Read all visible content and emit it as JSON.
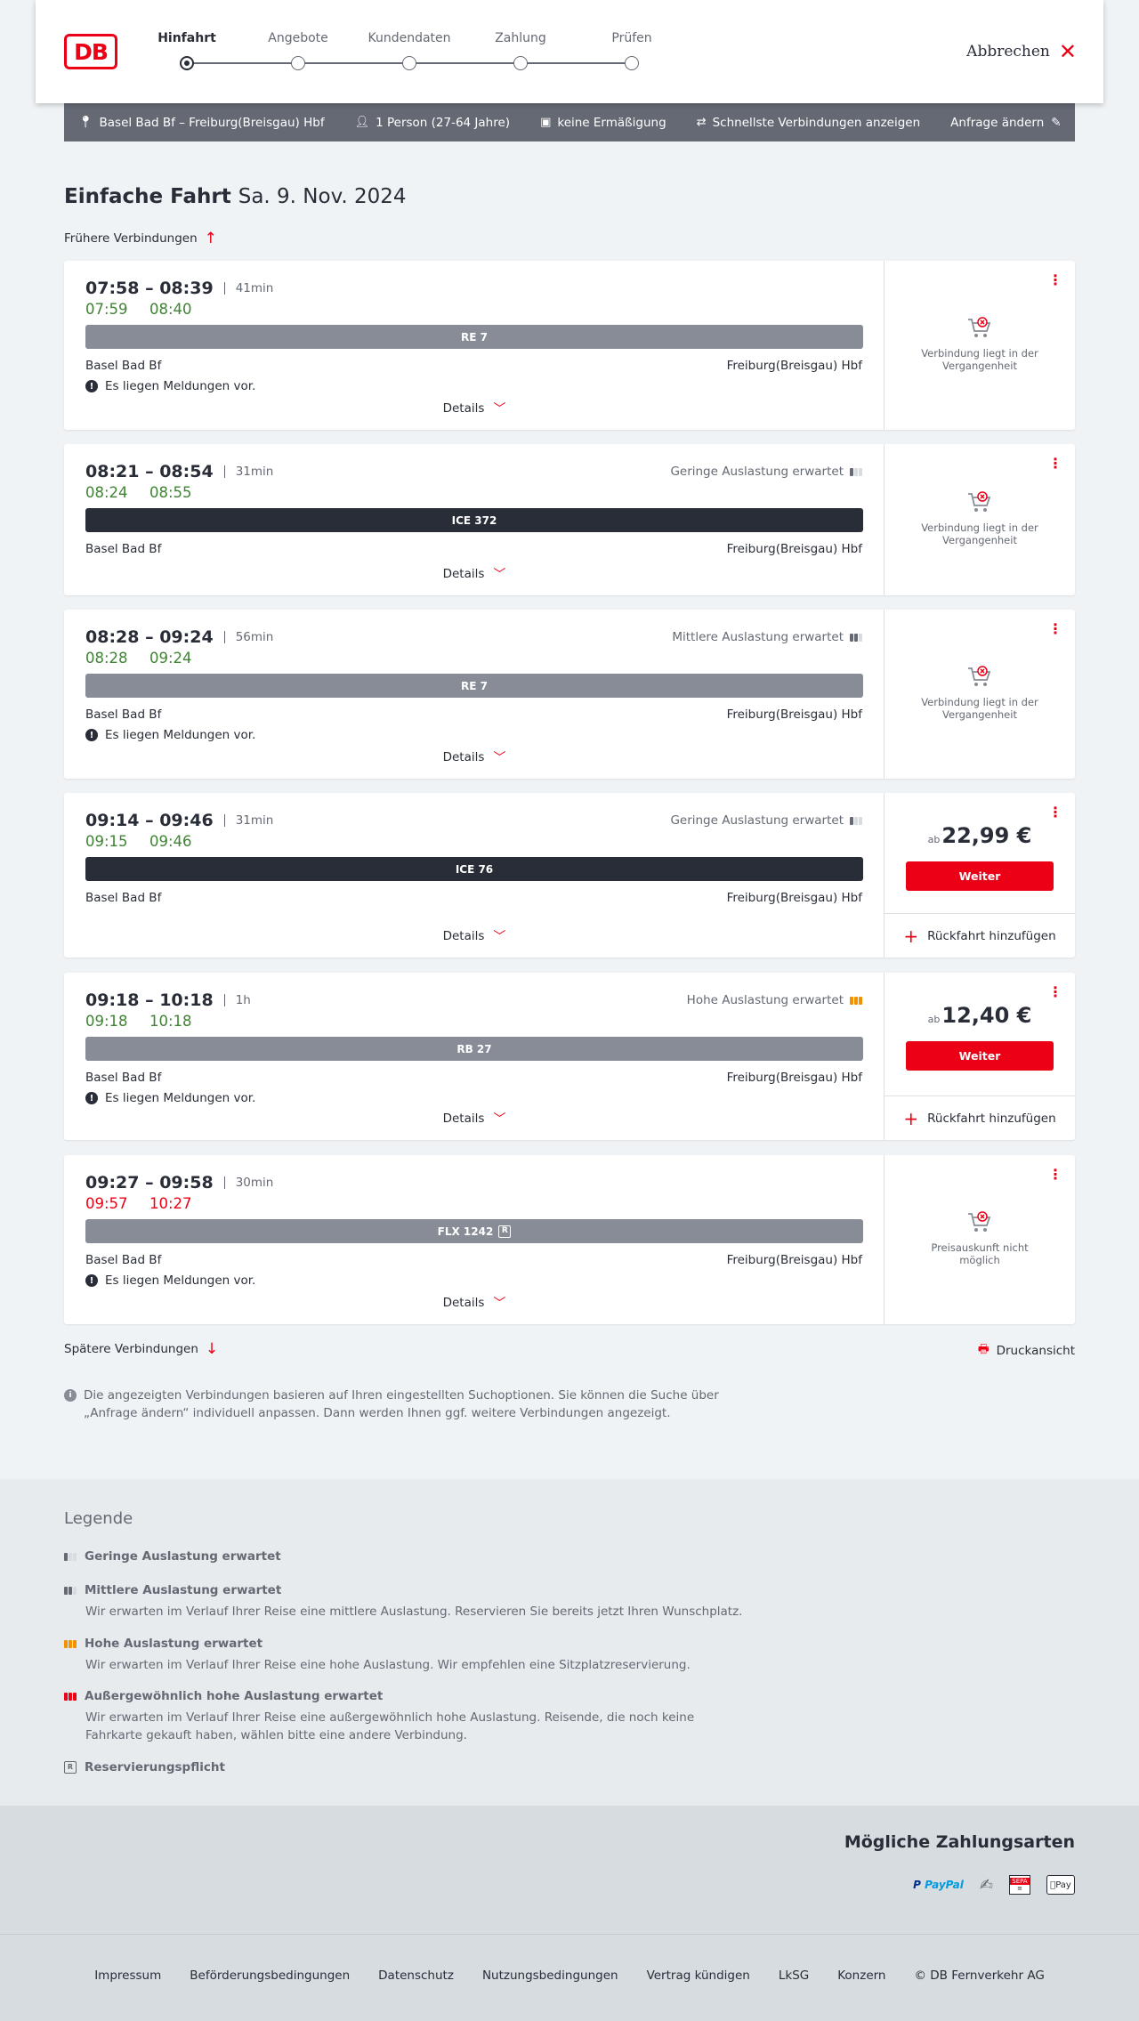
{
  "header": {
    "logo": "DB",
    "steps": [
      "Hinfahrt",
      "Angebote",
      "Kundendaten",
      "Zahlung",
      "Prüfen"
    ],
    "active_step": 0,
    "cancel_label": "Abbrechen"
  },
  "query": {
    "route": "Basel Bad Bf – Freiburg(Breisgau) Hbf",
    "persons": "1 Person (27-64 Jahre)",
    "discount": "keine Ermäßigung",
    "fastest": "Schnellste Verbindungen anzeigen",
    "change": "Anfrage ändern"
  },
  "page": {
    "title": "Einfache Fahrt",
    "date": "Sa. 9. Nov. 2024",
    "earlier": "Frühere Verbindungen",
    "later": "Spätere Verbindungen",
    "print": "Druckansicht",
    "info": "Die angezeigten Verbindungen basieren auf Ihren eingestellten Suchoptionen. Sie können die Suche über „Anfrage ändern“ individuell anpassen. Dann werden Ihnen ggf. weitere Verbindungen angezeigt."
  },
  "common": {
    "details": "Details",
    "note": "Es liegen Meldungen vor.",
    "from": "Basel Bad Bf",
    "to": "Freiburg(Breisgau) Hbf",
    "past": "Verbindung liegt in der Vergangenheit",
    "no_price": "Preisauskunft nicht möglich",
    "ab": "ab",
    "weiter": "Weiter",
    "return": "Rückfahrt hinzufügen"
  },
  "connections": [
    {
      "times": "07:58 – 08:39",
      "duration": "41min",
      "rt_dep": "07:59",
      "rt_arr": "08:40",
      "rt_color": "green",
      "load": "",
      "train": "RE 7",
      "note": true,
      "status": "past"
    },
    {
      "times": "08:21 – 08:54",
      "duration": "31min",
      "rt_dep": "08:24",
      "rt_arr": "08:55",
      "rt_color": "green",
      "load": "Geringe Auslastung erwartet",
      "train": "ICE 372",
      "note": false,
      "status": "past"
    },
    {
      "times": "08:28 – 09:24",
      "duration": "56min",
      "rt_dep": "08:28",
      "rt_arr": "09:24",
      "rt_color": "green",
      "load": "Mittlere Auslastung erwartet",
      "train": "RE 7",
      "note": true,
      "status": "past"
    },
    {
      "times": "09:14 – 09:46",
      "duration": "31min",
      "rt_dep": "09:15",
      "rt_arr": "09:46",
      "rt_color": "green",
      "load": "Geringe Auslastung erwartet",
      "train": "ICE 76",
      "note": false,
      "status": "price",
      "price": "22,99 €"
    },
    {
      "times": "09:18 – 10:18",
      "duration": "1h",
      "rt_dep": "09:18",
      "rt_arr": "10:18",
      "rt_color": "green",
      "load": "Hohe Auslastung erwartet",
      "train": "RB 27",
      "note": true,
      "status": "price",
      "price": "12,40 €"
    },
    {
      "times": "09:27 – 09:58",
      "duration": "30min",
      "rt_dep": "09:57",
      "rt_arr": "10:27",
      "rt_color": "red",
      "load": "",
      "train": "FLX 1242",
      "note": true,
      "status": "noprice",
      "reservation": "R"
    }
  ],
  "legend": {
    "title": "Legende",
    "items": [
      {
        "title": "Geringe Auslastung erwartet",
        "desc": ""
      },
      {
        "title": "Mittlere Auslastung erwartet",
        "desc": "Wir erwarten im Verlauf Ihrer Reise eine mittlere Auslastung. Reservieren Sie bereits jetzt Ihren Wunschplatz."
      },
      {
        "title": "Hohe Auslastung erwartet",
        "desc": "Wir erwarten im Verlauf Ihrer Reise eine hohe Auslastung. Wir empfehlen eine Sitzplatzreservierung."
      },
      {
        "title": "Außergewöhnlich hohe Auslastung erwartet",
        "desc": "Wir erwarten im Verlauf Ihrer Reise eine außergewöhnlich hohe Auslastung. Reisende, die noch keine Fahrkarte gekauft haben, wählen bitte eine andere Verbindung."
      },
      {
        "title": "Reservierungspflicht",
        "desc": ""
      }
    ]
  },
  "payment": {
    "title": "Mögliche Zahlungsarten",
    "paypal": "PayPal",
    "sepa": "SEPA",
    "applepay": "Pay"
  },
  "footer": {
    "links": [
      "Impressum",
      "Beförderungsbedingungen",
      "Datenschutz",
      "Nutzungsbedingungen",
      "Vertrag kündigen",
      "LkSG",
      "Konzern",
      "© DB Fernverkehr AG"
    ]
  },
  "colors": {
    "red": "#ec0016",
    "green": "#408335",
    "dark": "#282d37",
    "grey_bar": "#878c96",
    "high_load": "#f39200"
  }
}
